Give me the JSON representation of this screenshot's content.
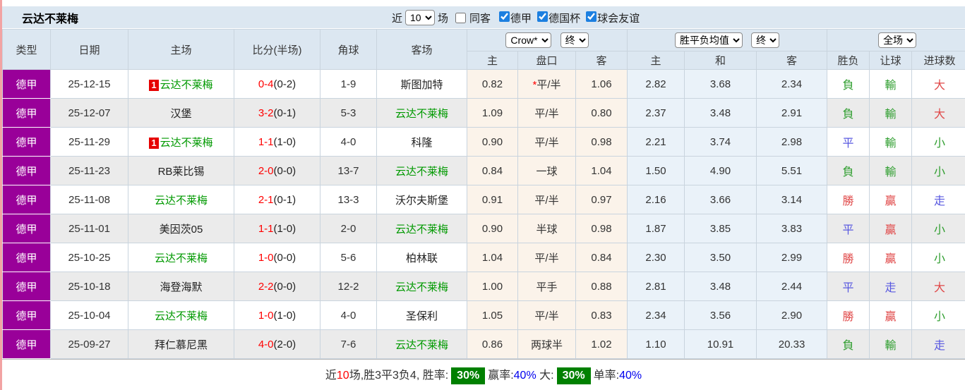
{
  "title": "云达不莱梅",
  "colors": {
    "league_badge_bg": "#990099",
    "self_team_green": "#009900",
    "score_red": "#ff0000",
    "win_red": "#e04848",
    "draw_blue": "#5858e0",
    "lose_green": "#2f9e2f",
    "rate_badge_green": "#008000",
    "rate_blue": "#0000ee",
    "header_bg": "#dce7f1",
    "handicap_col_bg": "#fbf3ea",
    "avg_col_bg": "#eaf2f9"
  },
  "controls": {
    "recent_label": "近",
    "recent_count": "10",
    "games_label": "场",
    "same_away": {
      "label": "同客",
      "checked": false
    },
    "leagues": [
      {
        "label": "德甲",
        "checked": true
      },
      {
        "label": "德国杯",
        "checked": true
      },
      {
        "label": "球会友谊",
        "checked": true
      }
    ]
  },
  "table": {
    "columns": {
      "type": "类型",
      "date": "日期",
      "home": "主场",
      "score": "比分(半场)",
      "corner": "角球",
      "away": "客场",
      "ah_sub": [
        "主",
        "盘口",
        "客"
      ],
      "avg_sub": [
        "主",
        "和",
        "客"
      ],
      "result_sub": [
        "胜负",
        "让球",
        "进球数"
      ]
    },
    "dropdowns": {
      "company": "Crow*",
      "company_state": "终",
      "avg": "胜平负均值",
      "avg_state": "终",
      "scope": "全场"
    },
    "rows": [
      {
        "league": "德甲",
        "date": "25-12-15",
        "home_badge": "1",
        "home": "云达不莱梅",
        "score_ft": "0-4",
        "score_ht": "(0-2)",
        "corner": "1-9",
        "away": "斯图加特",
        "ah_home": "0.82",
        "ah_star": "*",
        "ah_line": "平/半",
        "ah_away": "1.06",
        "avg_home": "2.82",
        "avg_draw": "3.68",
        "avg_away": "2.34",
        "wdl": "負",
        "wdl_tone": "green",
        "handicap": "輸",
        "handicap_tone": "green",
        "goals": "大",
        "goals_tone": "red"
      },
      {
        "league": "德甲",
        "date": "25-12-07",
        "home_badge": "",
        "home": "汉堡",
        "score_ft": "3-2",
        "score_ht": "(0-1)",
        "corner": "5-3",
        "away": "云达不莱梅",
        "ah_home": "1.09",
        "ah_star": "",
        "ah_line": "平/半",
        "ah_away": "0.80",
        "avg_home": "2.37",
        "avg_draw": "3.48",
        "avg_away": "2.91",
        "wdl": "負",
        "wdl_tone": "green",
        "handicap": "輸",
        "handicap_tone": "green",
        "goals": "大",
        "goals_tone": "red"
      },
      {
        "league": "德甲",
        "date": "25-11-29",
        "home_badge": "1",
        "home": "云达不莱梅",
        "score_ft": "1-1",
        "score_ht": "(1-0)",
        "corner": "4-0",
        "away": "科隆",
        "ah_home": "0.90",
        "ah_star": "",
        "ah_line": "平/半",
        "ah_away": "0.98",
        "avg_home": "2.21",
        "avg_draw": "3.74",
        "avg_away": "2.98",
        "wdl": "平",
        "wdl_tone": "blue",
        "handicap": "輸",
        "handicap_tone": "green",
        "goals": "小",
        "goals_tone": "green"
      },
      {
        "league": "德甲",
        "date": "25-11-23",
        "home_badge": "",
        "home": "RB莱比锡",
        "score_ft": "2-0",
        "score_ht": "(0-0)",
        "corner": "13-7",
        "away": "云达不莱梅",
        "ah_home": "0.84",
        "ah_star": "",
        "ah_line": "一球",
        "ah_away": "1.04",
        "avg_home": "1.50",
        "avg_draw": "4.90",
        "avg_away": "5.51",
        "wdl": "負",
        "wdl_tone": "green",
        "handicap": "輸",
        "handicap_tone": "green",
        "goals": "小",
        "goals_tone": "green"
      },
      {
        "league": "德甲",
        "date": "25-11-08",
        "home_badge": "",
        "home": "云达不莱梅",
        "score_ft": "2-1",
        "score_ht": "(0-1)",
        "corner": "13-3",
        "away": "沃尔夫斯堡",
        "ah_home": "0.91",
        "ah_star": "",
        "ah_line": "平/半",
        "ah_away": "0.97",
        "avg_home": "2.16",
        "avg_draw": "3.66",
        "avg_away": "3.14",
        "wdl": "勝",
        "wdl_tone": "red",
        "handicap": "贏",
        "handicap_tone": "red",
        "goals": "走",
        "goals_tone": "blue"
      },
      {
        "league": "德甲",
        "date": "25-11-01",
        "home_badge": "",
        "home": "美因茨05",
        "score_ft": "1-1",
        "score_ht": "(1-0)",
        "corner": "2-0",
        "away": "云达不莱梅",
        "ah_home": "0.90",
        "ah_star": "",
        "ah_line": "半球",
        "ah_away": "0.98",
        "avg_home": "1.87",
        "avg_draw": "3.85",
        "avg_away": "3.83",
        "wdl": "平",
        "wdl_tone": "blue",
        "handicap": "贏",
        "handicap_tone": "red",
        "goals": "小",
        "goals_tone": "green"
      },
      {
        "league": "德甲",
        "date": "25-10-25",
        "home_badge": "",
        "home": "云达不莱梅",
        "score_ft": "1-0",
        "score_ht": "(0-0)",
        "corner": "5-6",
        "away": "柏林联",
        "ah_home": "1.04",
        "ah_star": "",
        "ah_line": "平/半",
        "ah_away": "0.84",
        "avg_home": "2.30",
        "avg_draw": "3.50",
        "avg_away": "2.99",
        "wdl": "勝",
        "wdl_tone": "red",
        "handicap": "贏",
        "handicap_tone": "red",
        "goals": "小",
        "goals_tone": "green"
      },
      {
        "league": "德甲",
        "date": "25-10-18",
        "home_badge": "",
        "home": "海登海默",
        "score_ft": "2-2",
        "score_ht": "(0-0)",
        "corner": "12-2",
        "away": "云达不莱梅",
        "ah_home": "1.00",
        "ah_star": "",
        "ah_line": "平手",
        "ah_away": "0.88",
        "avg_home": "2.81",
        "avg_draw": "3.48",
        "avg_away": "2.44",
        "wdl": "平",
        "wdl_tone": "blue",
        "handicap": "走",
        "handicap_tone": "blue",
        "goals": "大",
        "goals_tone": "red"
      },
      {
        "league": "德甲",
        "date": "25-10-04",
        "home_badge": "",
        "home": "云达不莱梅",
        "score_ft": "1-0",
        "score_ht": "(1-0)",
        "corner": "4-0",
        "away": "圣保利",
        "ah_home": "1.05",
        "ah_star": "",
        "ah_line": "平/半",
        "ah_away": "0.83",
        "avg_home": "2.34",
        "avg_draw": "3.56",
        "avg_away": "2.90",
        "wdl": "勝",
        "wdl_tone": "red",
        "handicap": "贏",
        "handicap_tone": "red",
        "goals": "小",
        "goals_tone": "green"
      },
      {
        "league": "德甲",
        "date": "25-09-27",
        "home_badge": "",
        "home": "拜仁慕尼黑",
        "score_ft": "4-0",
        "score_ht": "(2-0)",
        "corner": "7-6",
        "away": "云达不莱梅",
        "ah_home": "0.86",
        "ah_star": "",
        "ah_line": "两球半",
        "ah_away": "1.02",
        "avg_home": "1.10",
        "avg_draw": "10.91",
        "avg_away": "20.33",
        "wdl": "負",
        "wdl_tone": "green",
        "handicap": "輸",
        "handicap_tone": "green",
        "goals": "走",
        "goals_tone": "blue"
      }
    ]
  },
  "footer": {
    "segments": [
      {
        "text": "近",
        "style": "plain"
      },
      {
        "text": "10",
        "style": "red"
      },
      {
        "text": "场,胜3平3负4, 胜率:",
        "style": "plain"
      },
      {
        "text": "30%",
        "style": "badge"
      },
      {
        "text": "赢率:",
        "style": "plain"
      },
      {
        "text": "40%",
        "style": "blue"
      },
      {
        "text": " 大:",
        "style": "plain"
      },
      {
        "text": "30%",
        "style": "badge"
      },
      {
        "text": "单率:",
        "style": "plain"
      },
      {
        "text": "40%",
        "style": "blue"
      }
    ]
  }
}
